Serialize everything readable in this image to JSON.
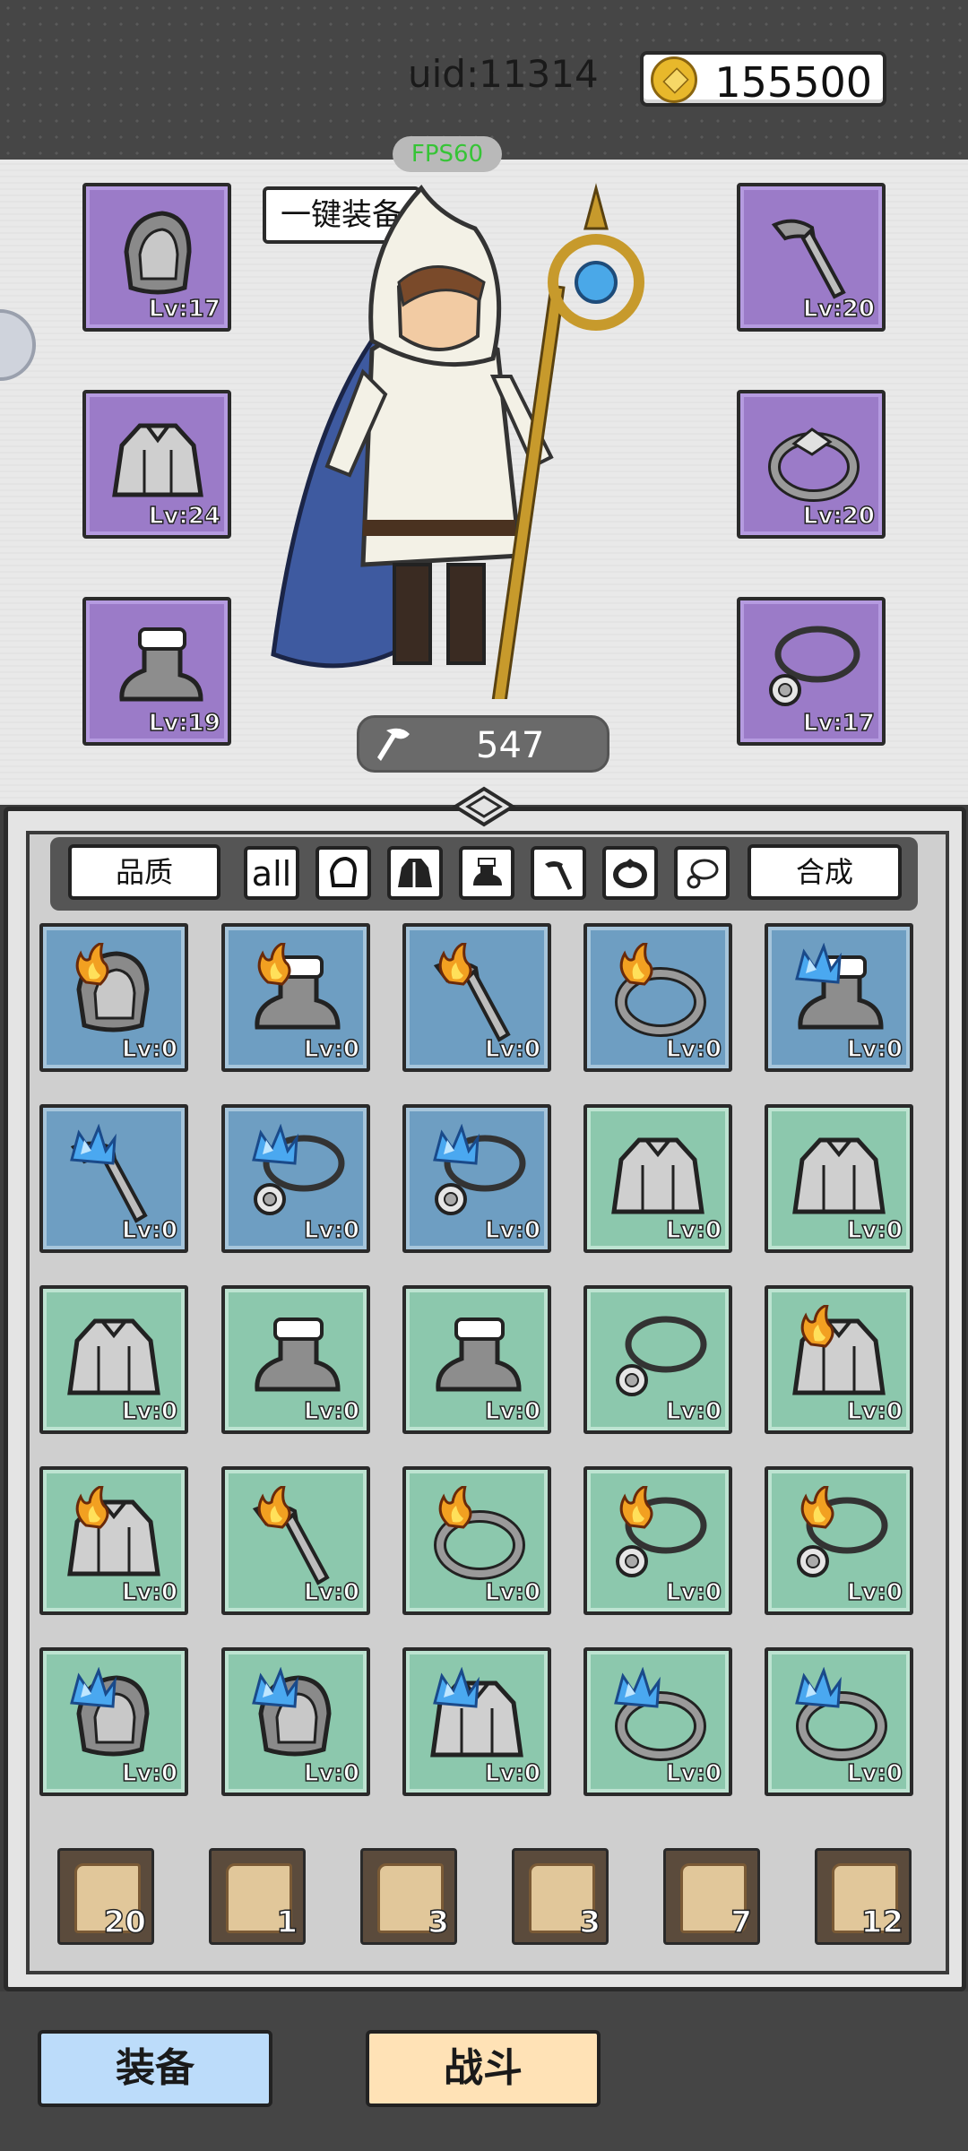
{
  "header": {
    "uid_label": "uid:11314",
    "coins": "155500",
    "fps": "FPS60"
  },
  "character": {
    "one_key_equip_label": "一键装备",
    "power": "547",
    "slots": [
      {
        "name": "helmet",
        "level": "Lv:17",
        "rarity": "purple"
      },
      {
        "name": "weapon",
        "level": "Lv:20",
        "rarity": "purple"
      },
      {
        "name": "armor",
        "level": "Lv:24",
        "rarity": "purple"
      },
      {
        "name": "ring",
        "level": "Lv:20",
        "rarity": "purple"
      },
      {
        "name": "boots",
        "level": "Lv:19",
        "rarity": "purple"
      },
      {
        "name": "necklace",
        "level": "Lv:17",
        "rarity": "purple"
      }
    ]
  },
  "inventory": {
    "quality_label": "品质",
    "all_label": "all",
    "merge_label": "合成",
    "filters": [
      "helmet-filter",
      "armor-filter",
      "boots-filter",
      "weapon-filter",
      "ring-filter",
      "necklace-filter"
    ],
    "items": [
      {
        "type": "helmet",
        "element": "fire",
        "rarity": "blue",
        "level": "Lv:0"
      },
      {
        "type": "boots",
        "element": "fire",
        "rarity": "blue",
        "level": "Lv:0"
      },
      {
        "type": "weapon",
        "element": "fire",
        "rarity": "blue",
        "level": "Lv:0"
      },
      {
        "type": "ring",
        "element": "fire",
        "rarity": "blue",
        "level": "Lv:0"
      },
      {
        "type": "boots",
        "element": "ice",
        "rarity": "blue",
        "level": "Lv:0"
      },
      {
        "type": "weapon",
        "element": "ice",
        "rarity": "blue",
        "level": "Lv:0"
      },
      {
        "type": "necklace",
        "element": "ice",
        "rarity": "blue",
        "level": "Lv:0"
      },
      {
        "type": "necklace",
        "element": "ice",
        "rarity": "blue",
        "level": "Lv:0"
      },
      {
        "type": "armor",
        "element": "none",
        "rarity": "green",
        "level": "Lv:0"
      },
      {
        "type": "armor",
        "element": "none",
        "rarity": "green",
        "level": "Lv:0"
      },
      {
        "type": "armor",
        "element": "none",
        "rarity": "green",
        "level": "Lv:0"
      },
      {
        "type": "boots",
        "element": "none",
        "rarity": "green",
        "level": "Lv:0"
      },
      {
        "type": "boots",
        "element": "none",
        "rarity": "green",
        "level": "Lv:0"
      },
      {
        "type": "necklace",
        "element": "none",
        "rarity": "green",
        "level": "Lv:0"
      },
      {
        "type": "armor",
        "element": "fire",
        "rarity": "green",
        "level": "Lv:0"
      },
      {
        "type": "armor",
        "element": "fire",
        "rarity": "green",
        "level": "Lv:0"
      },
      {
        "type": "weapon",
        "element": "fire",
        "rarity": "green",
        "level": "Lv:0"
      },
      {
        "type": "ring",
        "element": "fire",
        "rarity": "green",
        "level": "Lv:0"
      },
      {
        "type": "necklace",
        "element": "fire",
        "rarity": "green",
        "level": "Lv:0"
      },
      {
        "type": "necklace",
        "element": "fire",
        "rarity": "green",
        "level": "Lv:0"
      },
      {
        "type": "helmet",
        "element": "ice",
        "rarity": "green",
        "level": "Lv:0"
      },
      {
        "type": "helmet",
        "element": "ice",
        "rarity": "green",
        "level": "Lv:0"
      },
      {
        "type": "armor",
        "element": "ice",
        "rarity": "green",
        "level": "Lv:0"
      },
      {
        "type": "ring",
        "element": "ice",
        "rarity": "green",
        "level": "Lv:0"
      },
      {
        "type": "ring",
        "element": "ice",
        "rarity": "green",
        "level": "Lv:0"
      }
    ],
    "scrolls": [
      {
        "type": "helmet",
        "count": "20"
      },
      {
        "type": "armor",
        "count": "1"
      },
      {
        "type": "boots",
        "count": "3"
      },
      {
        "type": "weapon",
        "count": "3"
      },
      {
        "type": "ring",
        "count": "7"
      },
      {
        "type": "necklace",
        "count": "12"
      }
    ]
  },
  "bottom_tabs": {
    "equip_label": "装备",
    "battle_label": "战斗"
  },
  "colors": {
    "purple_slot": "#9b7bc8",
    "blue_item": "#6e9ec2",
    "green_item": "#8cc8ad",
    "fps_green": "#36c436"
  }
}
